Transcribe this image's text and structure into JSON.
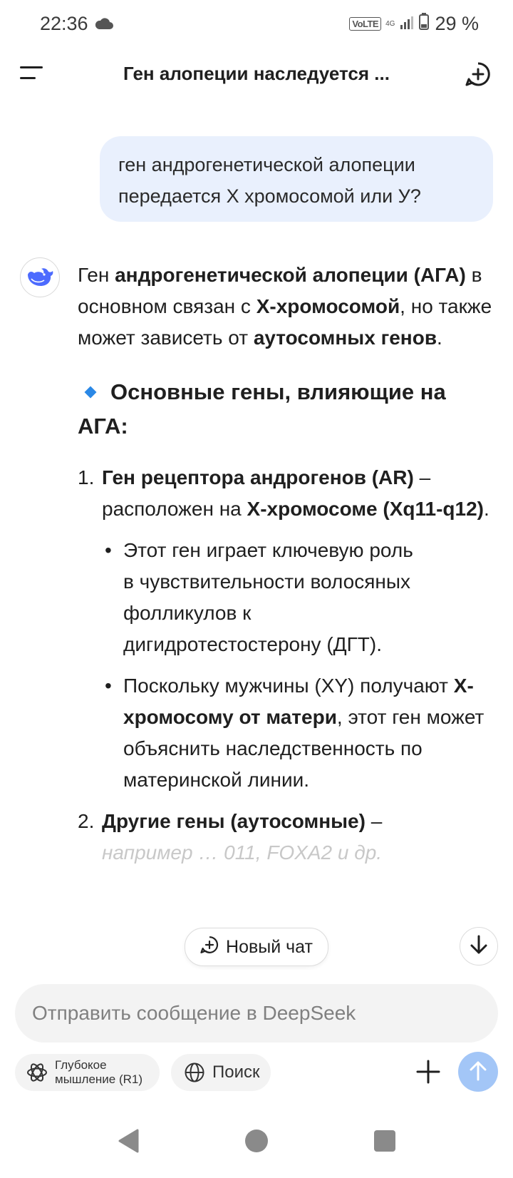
{
  "status_bar": {
    "time": "22:36",
    "weather_icon": "cloud-icon",
    "volte": "VoLTE",
    "network": "4G",
    "battery": "29 %"
  },
  "header": {
    "title": "Ген алопеции наследуется ...",
    "menu_icon": "menu-icon",
    "new_chat_icon": "new-chat-icon"
  },
  "user_message": {
    "line1": "ген андрогенетической алопеции",
    "line2": "передается Х хромосомой или У?"
  },
  "answer": {
    "intro": {
      "t1": "Ген ",
      "b1": "андрогенетической алопеции (АГА)",
      "t2": " в основном связан с ",
      "b2": "Х-хромосомой",
      "t3": ", но также может зависеть от ",
      "b3": "аутосомных генов",
      "t4": "."
    },
    "section_title": "Основные гены, влияющие на АГА:",
    "item1": {
      "num": "1.",
      "b1": "Ген рецептора андрогенов (AR)",
      "t1": " – расположен на ",
      "b2": "Х-хромосоме (Xq11-q12)",
      "t2": "."
    },
    "bullet1": "Этот ген играет ключевую роль в чувствительности волосяных фолликулов к дигидротестостерону (ДГТ).",
    "bullet2": {
      "t1": "Поскольку мужчины (XY) получают ",
      "b1": "Х-хромосому от матери",
      "t2": ", этот ген может объяснить наследственность по материнской линии."
    },
    "item2": {
      "num": "2.",
      "b1": "Другие гены (аутосомные)",
      "t1": " –",
      "faded": "например … 011, FOXA2 и др."
    }
  },
  "floating": {
    "new_chat_label": "Новый чат"
  },
  "composer": {
    "placeholder": "Отправить сообщение в DeepSeek",
    "deep_think_line1": "Глубокое",
    "deep_think_line2": "мышление (R1)",
    "search_label": "Поиск"
  },
  "colors": {
    "accent": "#2a88e6",
    "user_bubble": "#e9f0fd",
    "send_button": "#a3c6f7"
  }
}
